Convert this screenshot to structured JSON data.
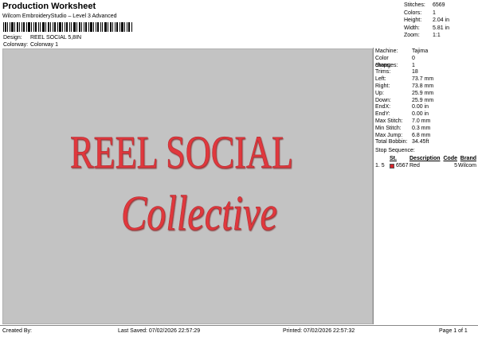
{
  "header": {
    "title": "Production Worksheet",
    "subtitle": "Wilcom EmbroideryStudio – Level 3 Advanced",
    "design_label": "Design:",
    "design_value": "REEL SOCIAL 5,8IN",
    "colorway_label": "Colorway:",
    "colorway_value": "Colorway 1"
  },
  "summary": [
    {
      "label": "Stitches:",
      "value": "6569"
    },
    {
      "label": "Colors:",
      "value": "1"
    },
    {
      "label": "Height:",
      "value": "2.04 in"
    },
    {
      "label": "Width:",
      "value": "5.81 in"
    },
    {
      "label": "Zoom:",
      "value": "1:1"
    }
  ],
  "preview": {
    "line1": "REEL SOCIAL",
    "line2": "Collective",
    "thread_color": "#e0393e",
    "background": "#c3c3c3"
  },
  "machine": [
    {
      "label": "Machine:",
      "value": "Tajima"
    },
    {
      "label": "Color changes:",
      "value": "0"
    },
    {
      "label": "Stops:",
      "value": "1"
    },
    {
      "label": "Trims:",
      "value": "18"
    },
    {
      "label": "Left:",
      "value": "73.7 mm"
    },
    {
      "label": "Right:",
      "value": "73.8 mm"
    },
    {
      "label": "Up:",
      "value": "25.9 mm"
    },
    {
      "label": "Down:",
      "value": "25.9 mm"
    },
    {
      "label": "EndX:",
      "value": "0.00 in"
    },
    {
      "label": "EndY:",
      "value": "0.00 in"
    },
    {
      "label": "Max Stitch:",
      "value": "7.0 mm"
    },
    {
      "label": "Min Stitch:",
      "value": "0.3 mm"
    },
    {
      "label": "Max Jump:",
      "value": "6.8 mm"
    },
    {
      "label": "Total Bobbin:",
      "value": "34.45ft"
    }
  ],
  "stop_sequence": {
    "title": "Stop Sequence:",
    "headers": {
      "st": "St.",
      "desc": "Description",
      "code": "Code",
      "brand": "Brand"
    },
    "rows": [
      {
        "n": "1.",
        "stop": "5",
        "stitches": "6567",
        "desc": "Red",
        "code": "5",
        "brand": "Wilcom",
        "color": "#d7242b"
      }
    ]
  },
  "footer": {
    "created_by": "Created By:",
    "last_saved": "Last Saved: 07/02/2026 22:57:29",
    "printed": "Printed: 07/02/2026 22:57:32",
    "page": "Page 1 of 1"
  }
}
